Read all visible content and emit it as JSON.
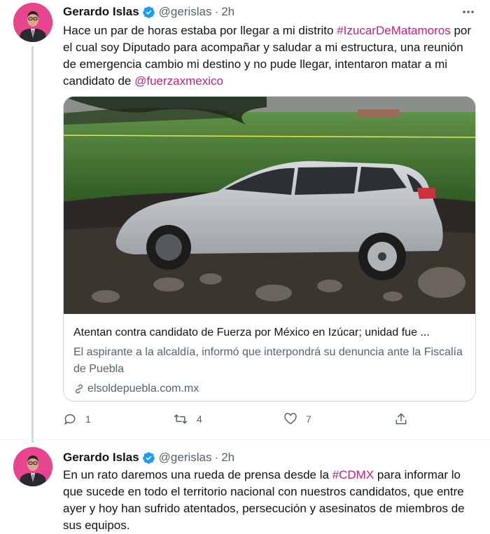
{
  "tweets": [
    {
      "author": {
        "name": "Gerardo Islas",
        "handle": "@gerislas",
        "time": "2h"
      },
      "text_parts": [
        "Hace un par de horas estaba por llegar a mi distrito ",
        "#IzucarDeMatamoros",
        " por el cual soy Diputado para acompañar y saludar a mi estructura, una reunión de emergencia cambio mi destino y no pude llegar, intentaron matar a mi candidato de ",
        "@fuerzaxmexico"
      ],
      "card": {
        "title": "Atentan contra candidato de Fuerza por México en Izúcar; unidad fue ...",
        "description": "El aspirante a la alcaldía, informó que interpondrá su denuncia ante la Fiscalía de Puebla",
        "domain": "elsoldepuebla.com.mx"
      },
      "actions": {
        "replies": "1",
        "retweets": "4",
        "likes": "7"
      }
    },
    {
      "author": {
        "name": "Gerardo Islas",
        "handle": "@gerislas",
        "time": "2h"
      },
      "text_parts": [
        "En un rato daremos una rueda de prensa desde la ",
        "#CDMX",
        " para informar lo que sucede en todo el territorio nacional con nuestros candidatos, que entre ayer y hoy han sufrido atentados, persecución y asesinatos de miembros de sus equipos."
      ]
    }
  ],
  "colors": {
    "accent": "#c0227e",
    "verified": "#1d9bf0",
    "avatar_bg": "#e8458f",
    "secondary_text": "#536471"
  },
  "icons": [
    "verified-badge-icon",
    "more-icon",
    "link-icon",
    "reply-icon",
    "retweet-icon",
    "like-icon",
    "share-icon"
  ]
}
